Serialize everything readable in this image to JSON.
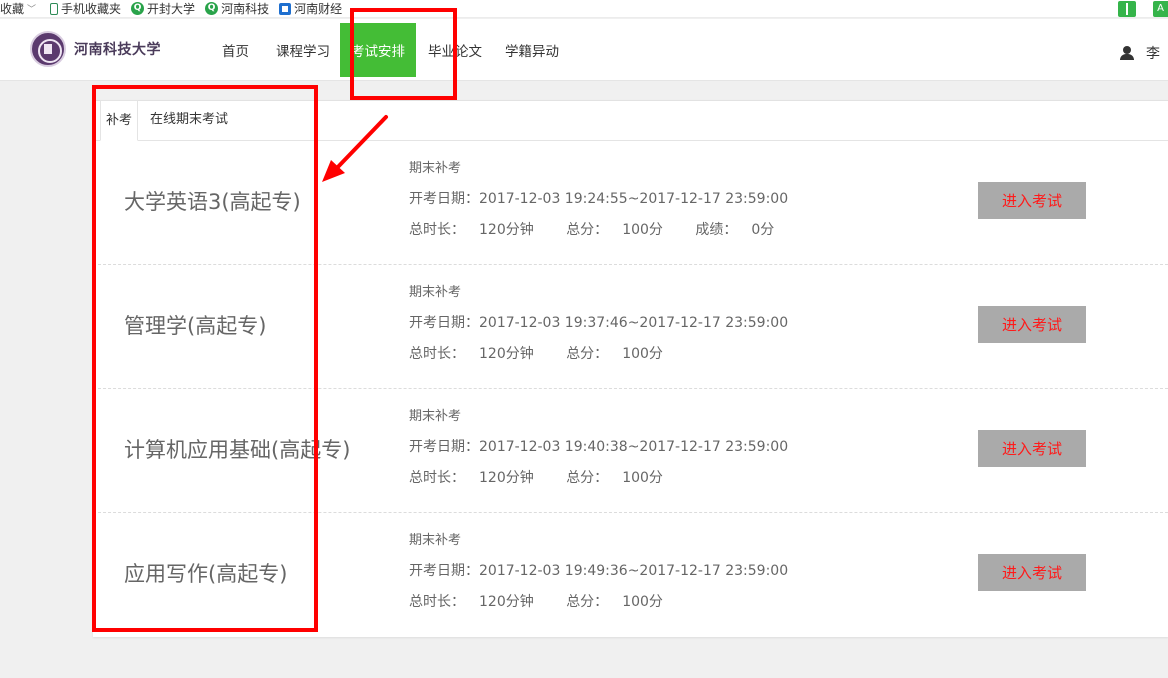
{
  "bookmarks": {
    "items": [
      {
        "label": "收藏",
        "icon": "caret-down-icon"
      },
      {
        "label": "手机收藏夹",
        "icon": "phone-icon"
      },
      {
        "label": "开封大学",
        "icon": "q-site-icon"
      },
      {
        "label": "河南科技",
        "icon": "q-site-icon"
      },
      {
        "label": "河南财经",
        "icon": "doc-site-icon"
      }
    ]
  },
  "header": {
    "logo_text": "河南科技大学",
    "nav": [
      {
        "label": "首页"
      },
      {
        "label": "课程学习"
      },
      {
        "label": "考试安排",
        "active": true
      },
      {
        "label": "毕业论文"
      },
      {
        "label": "学籍异动"
      }
    ],
    "user_name": "李",
    "accent_color": "#44bd36"
  },
  "tabs": [
    {
      "label": "补考",
      "active": true
    },
    {
      "label": "在线期末考试",
      "active": false
    }
  ],
  "exams": [
    {
      "title": "大学英语3(高起专)",
      "type": "期末补考",
      "date_label": "开考日期：",
      "date": "2017-12-03 19:24:55~2017-12-17 23:59:00",
      "duration_label": "总时长：",
      "duration": "120分钟",
      "total_label": "总分：",
      "total": "100分",
      "score_label": "成绩：",
      "score": "0分",
      "button": "进入考试"
    },
    {
      "title": "管理学(高起专)",
      "type": "期末补考",
      "date_label": "开考日期：",
      "date": "2017-12-03 19:37:46~2017-12-17 23:59:00",
      "duration_label": "总时长：",
      "duration": "120分钟",
      "total_label": "总分：",
      "total": "100分",
      "button": "进入考试"
    },
    {
      "title": "计算机应用基础(高起专)",
      "type": "期末补考",
      "date_label": "开考日期：",
      "date": "2017-12-03 19:40:38~2017-12-17 23:59:00",
      "duration_label": "总时长：",
      "duration": "120分钟",
      "total_label": "总分：",
      "total": "100分",
      "button": "进入考试"
    },
    {
      "title": "应用写作(高起专)",
      "type": "期末补考",
      "date_label": "开考日期：",
      "date": "2017-12-03 19:49:36~2017-12-17 23:59:00",
      "duration_label": "总时长：",
      "duration": "120分钟",
      "total_label": "总分：",
      "total": "100分",
      "button": "进入考试"
    }
  ],
  "colors": {
    "button_bg": "#aaaaaa",
    "button_text": "#ff1a1a",
    "annotation": "#ff0000"
  }
}
